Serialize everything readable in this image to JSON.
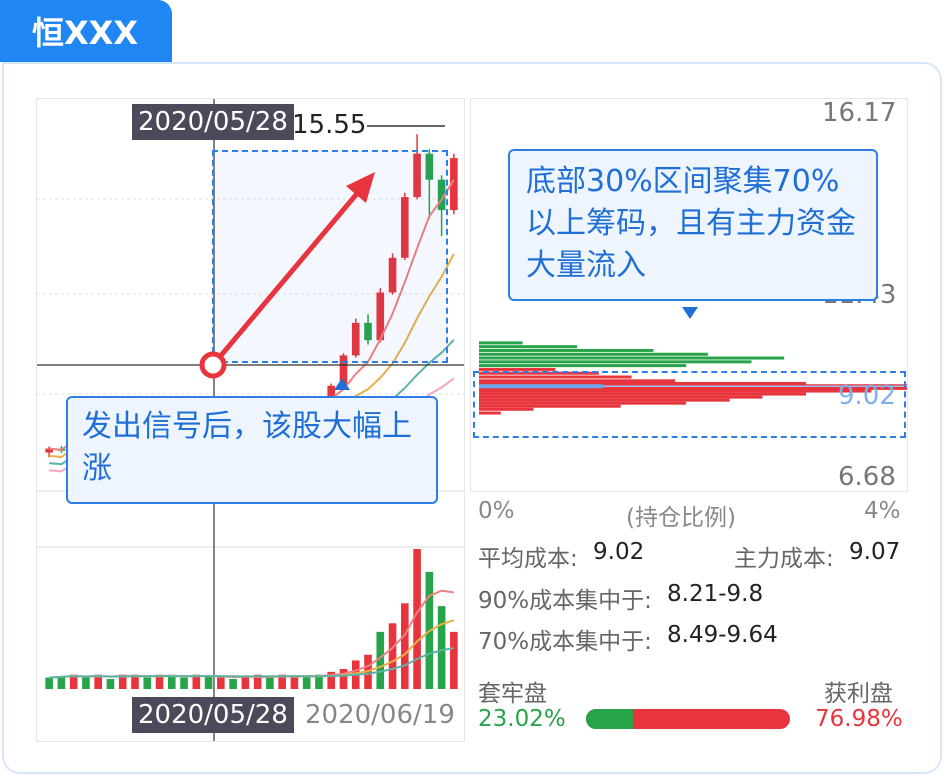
{
  "header": {
    "title": "恒XXX"
  },
  "chart_data": {
    "type": "candlestick",
    "cursor_date": "2020/05/28",
    "end_date": "2020/06/19",
    "max_price_label": "15.55",
    "candles": [
      [
        8.21,
        8.3,
        8.1,
        8.35
      ],
      [
        8.3,
        8.25,
        8.2,
        8.36
      ],
      [
        8.25,
        8.85,
        8.2,
        8.9
      ],
      [
        8.85,
        8.75,
        8.7,
        8.95
      ],
      [
        8.75,
        8.8,
        8.7,
        8.9
      ],
      [
        8.8,
        8.95,
        8.75,
        9.0
      ],
      [
        8.95,
        8.9,
        8.85,
        9.05
      ],
      [
        8.9,
        8.95,
        8.85,
        9.0
      ],
      [
        8.95,
        9.0,
        8.9,
        9.05
      ],
      [
        9.0,
        8.98,
        8.95,
        9.02
      ],
      [
        8.98,
        9.0,
        8.95,
        9.03
      ],
      [
        9.0,
        9.02,
        8.97,
        9.06
      ],
      [
        9.02,
        9.1,
        9.0,
        9.12
      ],
      [
        9.1,
        9.05,
        9.02,
        9.14
      ],
      [
        9.05,
        9.1,
        9.03,
        9.12
      ],
      [
        9.1,
        9.08,
        9.05,
        9.12
      ],
      [
        9.08,
        9.2,
        9.05,
        9.22
      ],
      [
        9.2,
        9.28,
        9.16,
        9.3
      ],
      [
        9.28,
        9.4,
        9.25,
        9.45
      ],
      [
        9.4,
        9.35,
        9.3,
        9.45
      ],
      [
        9.35,
        9.45,
        9.32,
        9.48
      ],
      [
        9.45,
        9.4,
        9.38,
        9.5
      ],
      [
        9.4,
        9.3,
        9.25,
        9.45
      ],
      [
        9.3,
        9.75,
        9.28,
        9.8
      ],
      [
        9.75,
        10.45,
        9.7,
        10.5
      ],
      [
        10.45,
        11.2,
        10.4,
        11.3
      ],
      [
        11.2,
        10.8,
        10.7,
        11.4
      ],
      [
        10.8,
        11.9,
        10.75,
        12.0
      ],
      [
        11.9,
        12.7,
        11.85,
        12.8
      ],
      [
        12.7,
        14.1,
        12.65,
        14.2
      ],
      [
        14.1,
        15.1,
        14.05,
        15.55
      ],
      [
        15.1,
        14.5,
        13.6,
        15.2
      ],
      [
        14.5,
        13.8,
        13.2,
        14.6
      ],
      [
        13.8,
        15.0,
        13.7,
        15.1
      ]
    ],
    "volumes": [
      8,
      9,
      10,
      8,
      10,
      7,
      10,
      10,
      8,
      10,
      9,
      8,
      10,
      9,
      8,
      7,
      9,
      10,
      8,
      10,
      8,
      9,
      10,
      12,
      14,
      20,
      24,
      40,
      46,
      60,
      98,
      82,
      58,
      40
    ],
    "volume_colors": [
      "g",
      "g",
      "r",
      "g",
      "r",
      "g",
      "r",
      "r",
      "g",
      "r",
      "g",
      "g",
      "r",
      "g",
      "r",
      "g",
      "r",
      "r",
      "g",
      "r",
      "r",
      "g",
      "g",
      "r",
      "r",
      "r",
      "r",
      "g",
      "r",
      "r",
      "r",
      "g",
      "g",
      "r"
    ],
    "chip_distribution": {
      "price_max": "16.17",
      "price_mid": "11.43",
      "price_avg": "9.02",
      "price_min": "6.68",
      "x_left": "0%",
      "x_label": "(持仓比例)",
      "x_right": "4%",
      "bars": [
        [
          10.15,
          0.4,
          "g"
        ],
        [
          10.05,
          0.9,
          "g"
        ],
        [
          9.95,
          1.6,
          "g"
        ],
        [
          9.85,
          2.1,
          "g"
        ],
        [
          9.75,
          2.8,
          "g"
        ],
        [
          9.65,
          2.5,
          "g"
        ],
        [
          9.55,
          1.9,
          "g"
        ],
        [
          9.45,
          0.7,
          "r"
        ],
        [
          9.35,
          1.1,
          "r"
        ],
        [
          9.25,
          1.4,
          "r"
        ],
        [
          9.15,
          1.8,
          "r"
        ],
        [
          9.08,
          3.0,
          "r"
        ],
        [
          9.02,
          4.4,
          "r"
        ],
        [
          8.95,
          4.1,
          "r"
        ],
        [
          8.88,
          3.6,
          "r"
        ],
        [
          8.8,
          3.0,
          "r"
        ],
        [
          8.72,
          2.6,
          "r"
        ],
        [
          8.64,
          2.3,
          "r"
        ],
        [
          8.56,
          1.9,
          "r"
        ],
        [
          8.48,
          1.3,
          "r"
        ],
        [
          8.4,
          0.5,
          "r"
        ],
        [
          8.3,
          0.2,
          "r"
        ]
      ]
    }
  },
  "annotations": {
    "left_callout": "发出信号后，该股大幅上涨",
    "right_callout": "底部30%区间聚集70%以上筹码，且有主力资金大量流入"
  },
  "stats": {
    "avg_cost_label": "平均成本:",
    "avg_cost_value": "9.02",
    "main_cost_label": "主力成本:",
    "main_cost_value": "9.07",
    "range90_label": "90%成本集中于:",
    "range90_value": "8.21-9.8",
    "range70_label": "70%成本集中于:",
    "range70_value": "8.49-9.64",
    "trapped_label": "套牢盘",
    "trapped_value": "23.02%",
    "profit_label": "获利盘",
    "profit_value": "76.98%",
    "trapped_fraction": 0.2302,
    "colors": {
      "up": "#e8343c",
      "down": "#27a349",
      "accent": "#2d7fe6"
    }
  }
}
